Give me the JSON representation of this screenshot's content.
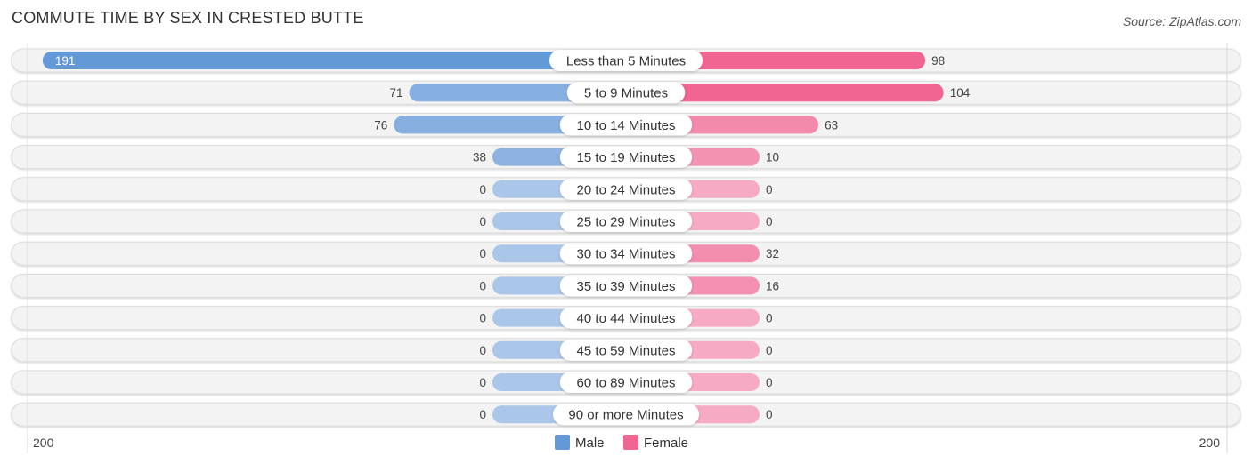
{
  "chart_data": {
    "type": "bar",
    "orientation": "horizontal-diverging",
    "title": "COMMUTE TIME BY SEX IN CRESTED BUTTE",
    "source": "Source: ZipAtlas.com",
    "categories": [
      "Less than 5 Minutes",
      "5 to 9 Minutes",
      "10 to 14 Minutes",
      "15 to 19 Minutes",
      "20 to 24 Minutes",
      "25 to 29 Minutes",
      "30 to 34 Minutes",
      "35 to 39 Minutes",
      "40 to 44 Minutes",
      "45 to 59 Minutes",
      "60 to 89 Minutes",
      "90 or more Minutes"
    ],
    "series": [
      {
        "name": "Male",
        "color": "#6499d8",
        "values": [
          191,
          71,
          76,
          38,
          0,
          0,
          0,
          0,
          0,
          0,
          0,
          0
        ]
      },
      {
        "name": "Female",
        "color": "#f06592",
        "values": [
          98,
          104,
          63,
          10,
          0,
          0,
          32,
          16,
          0,
          0,
          0,
          0
        ]
      }
    ],
    "axis": {
      "left_label": "200",
      "right_label": "200",
      "max": 200
    },
    "legend": {
      "placement": "bottom-center",
      "entries": [
        "Male",
        "Female"
      ]
    },
    "grid": false
  }
}
